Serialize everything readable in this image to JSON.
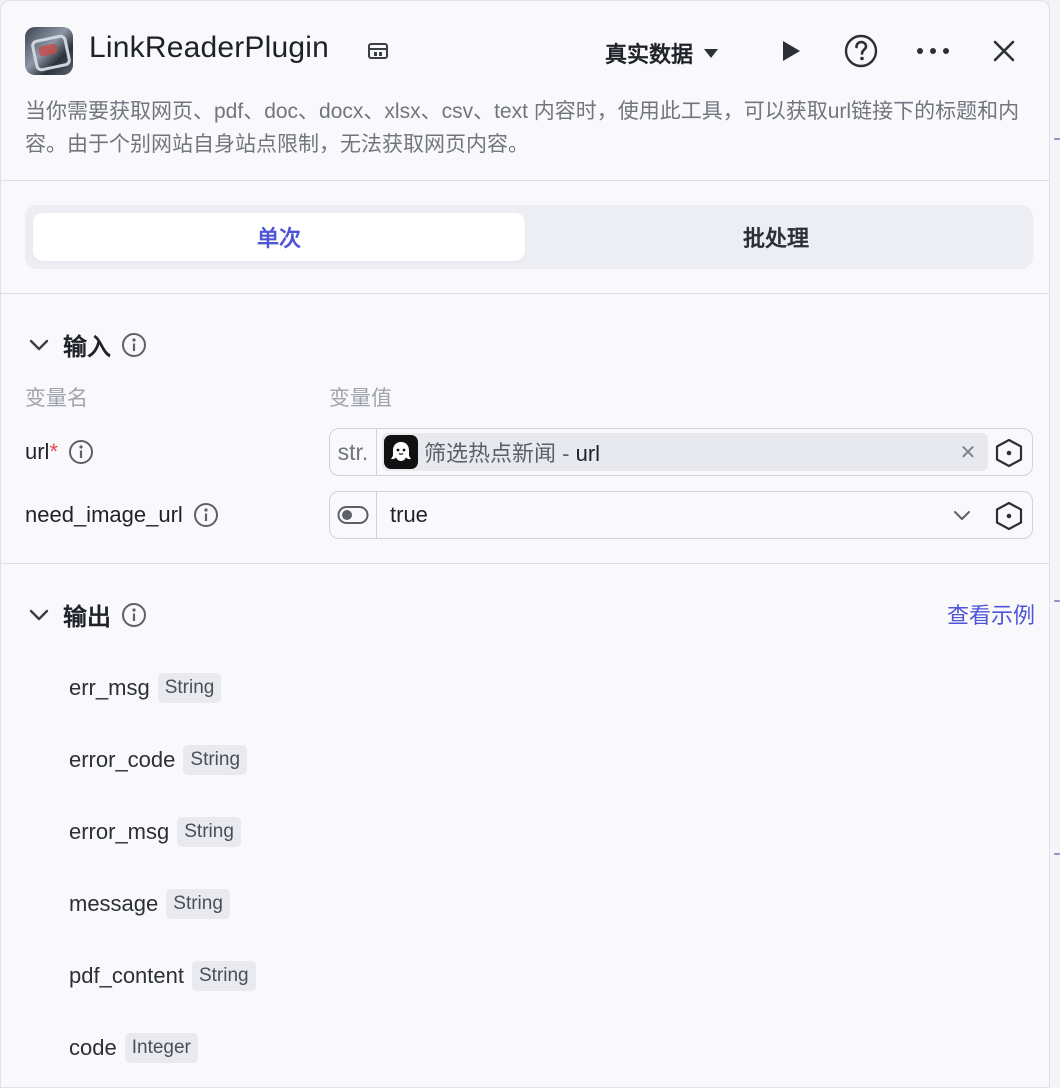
{
  "header": {
    "title": "LinkReaderPlugin",
    "mode_label": "真实数据",
    "description": "当你需要获取网页、pdf、doc、docx、xlsx、csv、text 内容时，使用此工具，可以获取url链接下的标题和内容。由于个别网站自身站点限制，无法获取网页内容。",
    "icons": [
      "plugin-logo",
      "store-icon",
      "caret-down-icon",
      "play-icon",
      "help-icon",
      "more-icon",
      "close-icon"
    ]
  },
  "tabs": [
    {
      "label": "单次",
      "active": true
    },
    {
      "label": "批处理",
      "active": false
    }
  ],
  "input_section": {
    "title": "输入",
    "col_name": "变量名",
    "col_value": "变量值",
    "params": [
      {
        "name": "url",
        "required_mark": "*",
        "type_label": "str.",
        "ref_source": "筛选热点新闻",
        "ref_sep": " - ",
        "ref_field": "url"
      },
      {
        "name": "need_image_url",
        "value": "true",
        "type_icon": "toggle-icon"
      }
    ]
  },
  "output_section": {
    "title": "输出",
    "example_link": "查看示例",
    "outputs": [
      {
        "name": "err_msg",
        "type": "String"
      },
      {
        "name": "error_code",
        "type": "String"
      },
      {
        "name": "error_msg",
        "type": "String"
      },
      {
        "name": "message",
        "type": "String"
      },
      {
        "name": "pdf_content",
        "type": "String"
      },
      {
        "name": "code",
        "type": "Integer"
      }
    ]
  },
  "colors": {
    "accent": "#4e55d9",
    "required": "#e5484d",
    "muted": "#71757e"
  }
}
